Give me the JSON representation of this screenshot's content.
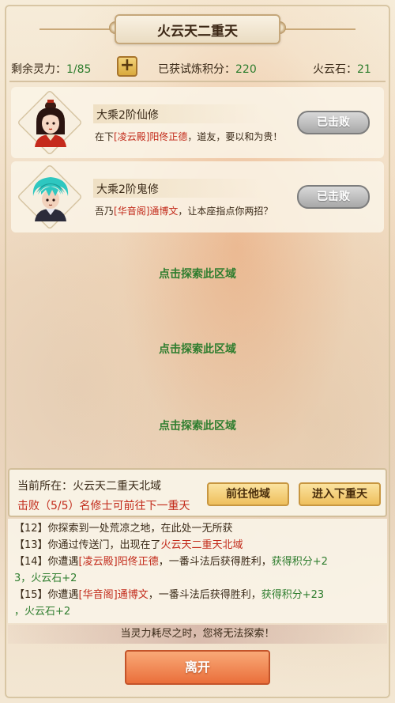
{
  "title": "火云天二重天",
  "stats": {
    "spirit_label": "剩余灵力：",
    "spirit_value": "1/85",
    "plus_label": "+",
    "points_label": "已获试炼积分：",
    "points_value": "220",
    "stone_label": "火云石：",
    "stone_value": "21"
  },
  "opponents": [
    {
      "name": "大乘2阶仙修",
      "line_prefix": "在下",
      "line_sect": "[凌云殿]",
      "line_person": "阳佟正德",
      "line_suffix": "，道友，要以和为贵！",
      "status": "已击败",
      "avatar_icon": "female-cultivator-portrait"
    },
    {
      "name": "大乘2阶鬼修",
      "line_prefix": "吾乃",
      "line_sect": "[华音阁]",
      "line_person": "通博文",
      "line_suffix": "，让本座指点你两招？",
      "status": "已击败",
      "avatar_icon": "cyan-haired-cultivator-portrait"
    }
  ],
  "explore_areas": [
    "点击探索此区域",
    "点击探索此区域",
    "点击探索此区域"
  ],
  "location": {
    "current": "当前所在：火云天二重天北域",
    "progress": "击败（5/5）名修士可前往下一重天",
    "go_other": "前往他域",
    "next_layer": "进入下重天"
  },
  "log": {
    "l1": "【12】你探索到一处荒凉之地，在此处一无所获",
    "l2_a": "【13】你通过传送门，出现在了",
    "l2_b": "火云天二重天北域",
    "l3_a": "【14】你遭遇",
    "l3_b": "[凌云殿]阳佟正德",
    "l3_c": "，一番斗法后获得胜利，",
    "l3_d": "获得积分+2",
    "l4_a": "3，火云石+2",
    "l5_a": "【15】你遭遇",
    "l5_b": "[华音阁]通博文",
    "l5_c": "，一番斗法后获得胜利，",
    "l5_d": "获得积分+23",
    "l6_a": "，火云石+2"
  },
  "warning": "当灵力耗尽之时，您将无法探索！",
  "leave": "离开",
  "colors": {
    "green": "#2e7d2e",
    "red": "#c22a1a",
    "leave_button": "#ea6f3b",
    "gold_button": "#eebf5c"
  }
}
